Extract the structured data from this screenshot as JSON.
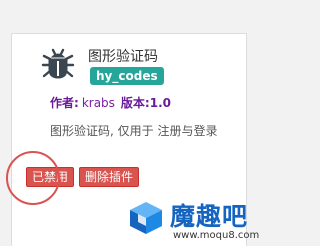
{
  "plugin": {
    "icon": "bug-icon",
    "name": "图形验证码",
    "code": "hy_codes",
    "author_label": "作者:",
    "author": "krabs",
    "version_label": "版本:",
    "version": "1.0",
    "description": "图形验证码, 仅用于 注册与登录"
  },
  "actions": {
    "disabled_label": "已禁用",
    "delete_label": "删除插件"
  },
  "watermark": {
    "brand": "魔趣吧",
    "url": "www.moqu8.com"
  },
  "colors": {
    "badge": "#26a69a",
    "button": "#d9534f",
    "meta": "#6a1b9a",
    "watermark": "#1565c0"
  }
}
